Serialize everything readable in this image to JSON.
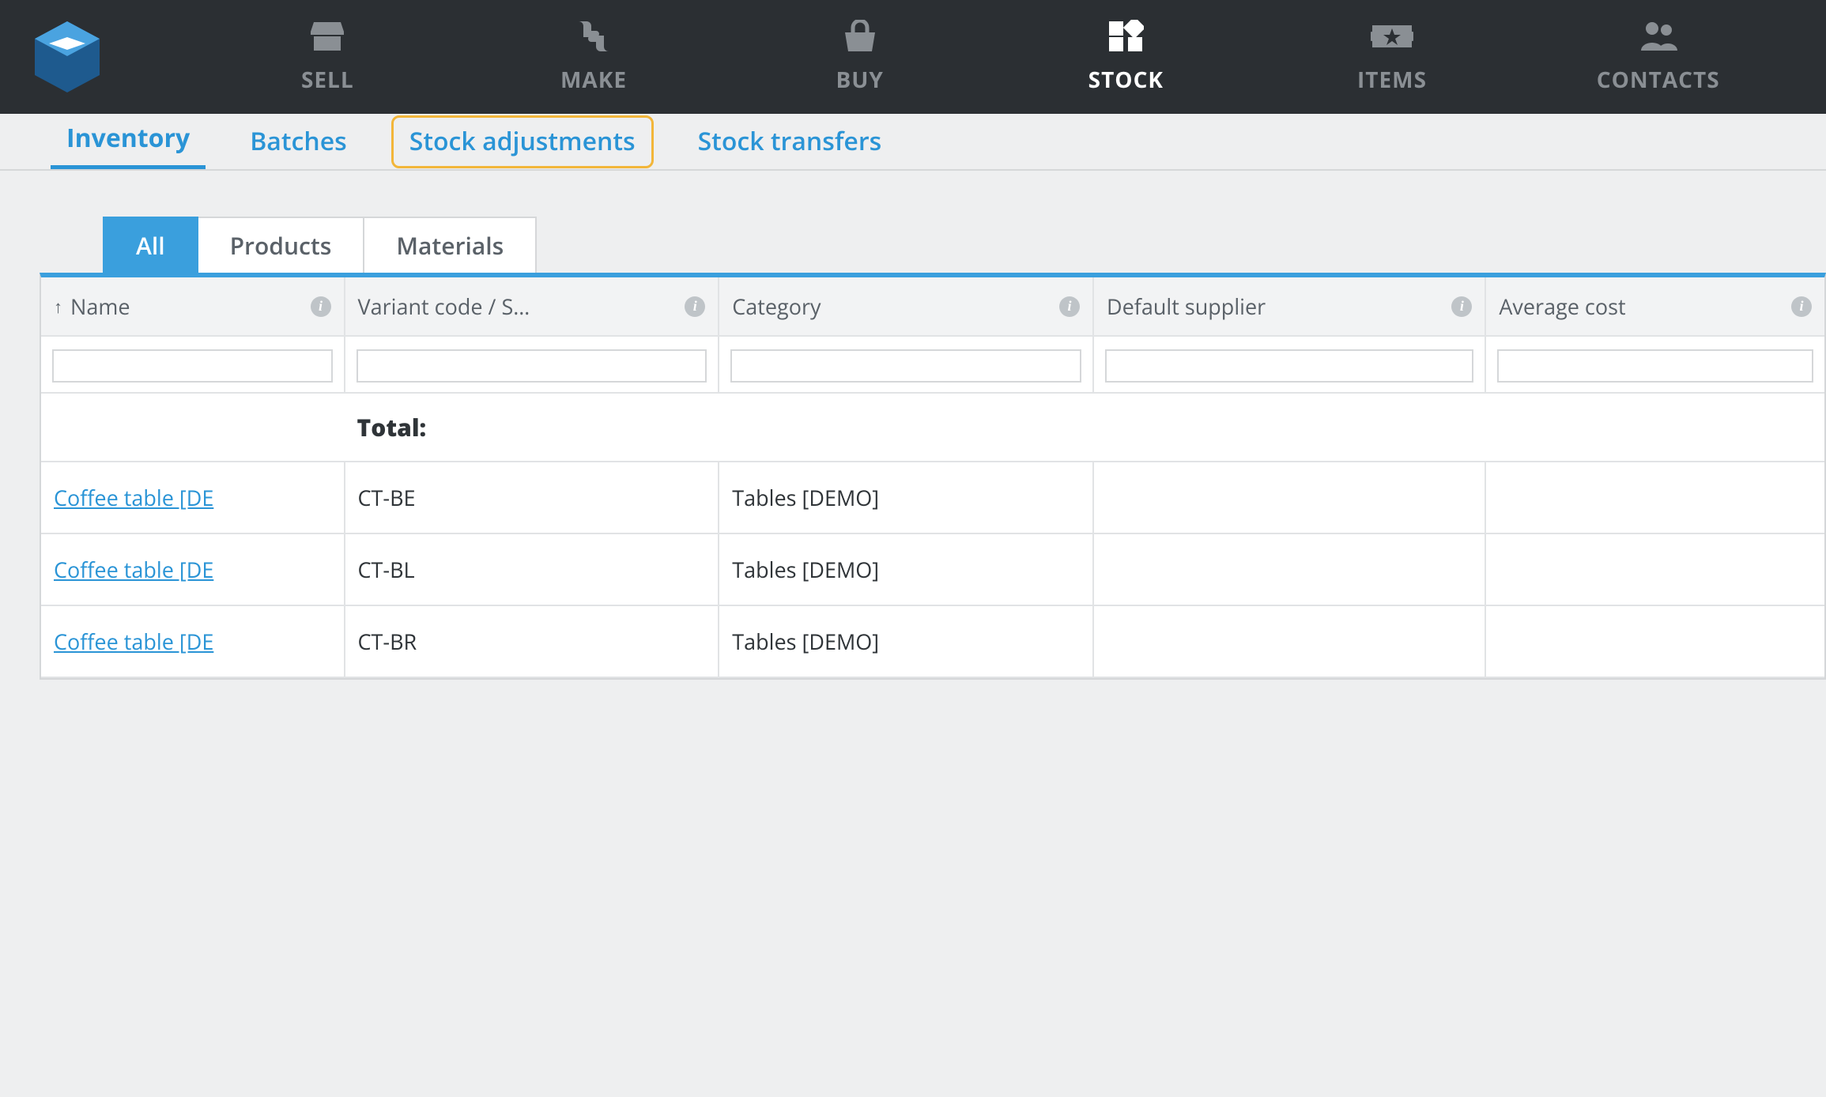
{
  "topnav": {
    "items": [
      {
        "label": "SELL",
        "icon": "store-icon",
        "active": false
      },
      {
        "label": "MAKE",
        "icon": "thumbs-icon",
        "active": false
      },
      {
        "label": "BUY",
        "icon": "basket-icon",
        "active": false
      },
      {
        "label": "STOCK",
        "icon": "grid-icon",
        "active": true
      },
      {
        "label": "ITEMS",
        "icon": "ticket-star-icon",
        "active": false
      },
      {
        "label": "CONTACTS",
        "icon": "people-icon",
        "active": false
      }
    ]
  },
  "subnav": {
    "items": [
      {
        "label": "Inventory",
        "state": "active"
      },
      {
        "label": "Batches",
        "state": ""
      },
      {
        "label": "Stock adjustments",
        "state": "highlighted"
      },
      {
        "label": "Stock transfers",
        "state": ""
      }
    ]
  },
  "filterTabs": {
    "items": [
      {
        "label": "All",
        "active": true
      },
      {
        "label": "Products",
        "active": false
      },
      {
        "label": "Materials",
        "active": false
      }
    ]
  },
  "table": {
    "columns": [
      {
        "label": "Name",
        "sorted": "asc",
        "info": true
      },
      {
        "label": "Variant code / S…",
        "info": true
      },
      {
        "label": "Category",
        "info": true
      },
      {
        "label": "Default supplier",
        "info": true
      },
      {
        "label": "Average cost",
        "info": true
      }
    ],
    "totalLabel": "Total:",
    "rows": [
      {
        "name": "Coffee table [DE",
        "code": "CT-BE",
        "category": "Tables [DEMO]",
        "supplier": "",
        "avgcost": ""
      },
      {
        "name": "Coffee table [DE",
        "code": "CT-BL",
        "category": "Tables [DEMO]",
        "supplier": "",
        "avgcost": ""
      },
      {
        "name": "Coffee table [DE",
        "code": "CT-BR",
        "category": "Tables [DEMO]",
        "supplier": "",
        "avgcost": ""
      }
    ]
  }
}
